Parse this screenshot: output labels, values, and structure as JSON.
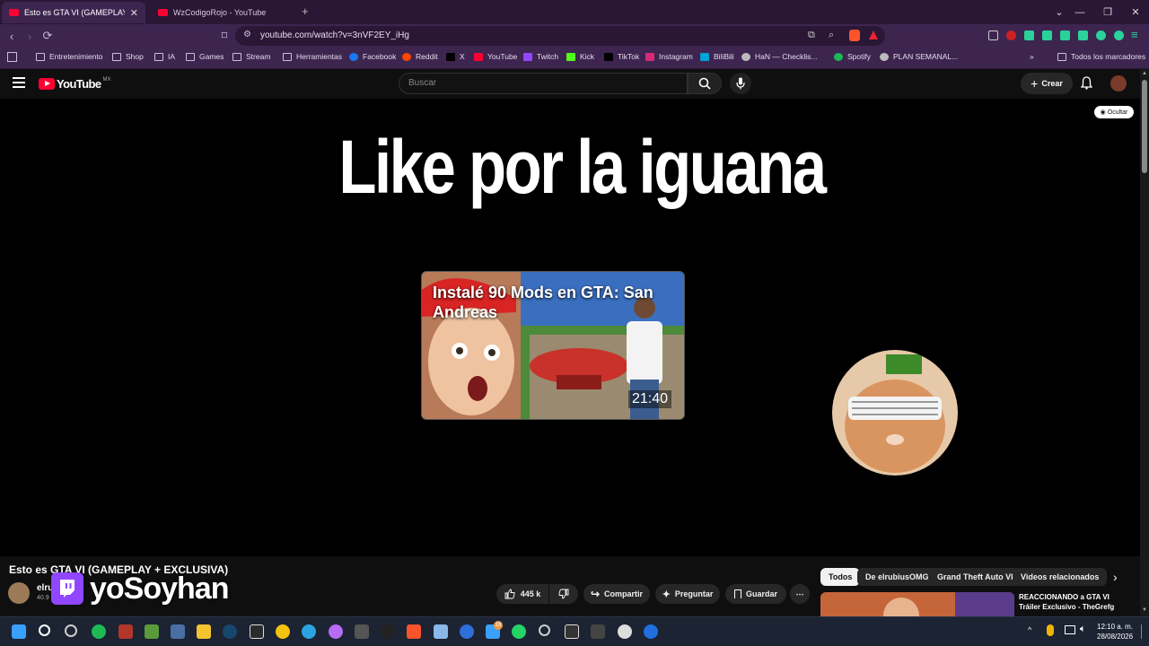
{
  "browser": {
    "tabs": [
      {
        "title": "Esto es GTA VI (GAMEPLAY + EXCLUSIVA)",
        "active": true
      },
      {
        "title": "WzCodigoRojo - YouTube",
        "active": false
      }
    ],
    "new_tab": "+",
    "url": "youtube.com/watch?v=3nVF2EY_iHg",
    "bookmarks": [
      "Entretenimiento",
      "Shop",
      "IA",
      "Games",
      "Stream",
      "Herramientas",
      "Facebook",
      "Reddit",
      "X",
      "YouTube",
      "Twitch",
      "Kick",
      "TikTok",
      "Instagram",
      "BiliBili",
      "HaN — Checklis...",
      "Spotify",
      "PLAN SEMANAL..."
    ],
    "all_bookmarks": "Todos los marcadores",
    "more_bookmarks": "»"
  },
  "youtube": {
    "logo": "YouTube",
    "region": "MX",
    "search_placeholder": "Buscar",
    "create_label": "Crear"
  },
  "video": {
    "overlay_text": "Like por la iguana",
    "endcard_title": "Instalé 90 Mods en GTA: San Andreas",
    "endcard_duration": "21:40",
    "hide_label": "Ocultar",
    "title": "Esto es GTA VI (GAMEPLAY + EXCLUSIVA)",
    "channel_partial": "elru",
    "subs_partial": "40.9",
    "streamer_overlay": "yoSoyhan",
    "likes": "445 k",
    "share": "Compartir",
    "ask": "Preguntar",
    "save": "Guardar"
  },
  "filters": [
    "Todos",
    "De elrubiusOMG",
    "Grand Theft Auto VI",
    "Videos relacionados"
  ],
  "recommended": {
    "title": "REACCIONANDO a GTA VI Tráiler Exclusivo - TheGrefg"
  },
  "taskbar": {
    "time": "12:10 a. m.",
    "date": "28/08/2026",
    "badge": "19"
  },
  "colors": {
    "tab_bg": "#2a1736",
    "toolbar_bg": "#3d2550",
    "yt_red": "#ff0033"
  }
}
